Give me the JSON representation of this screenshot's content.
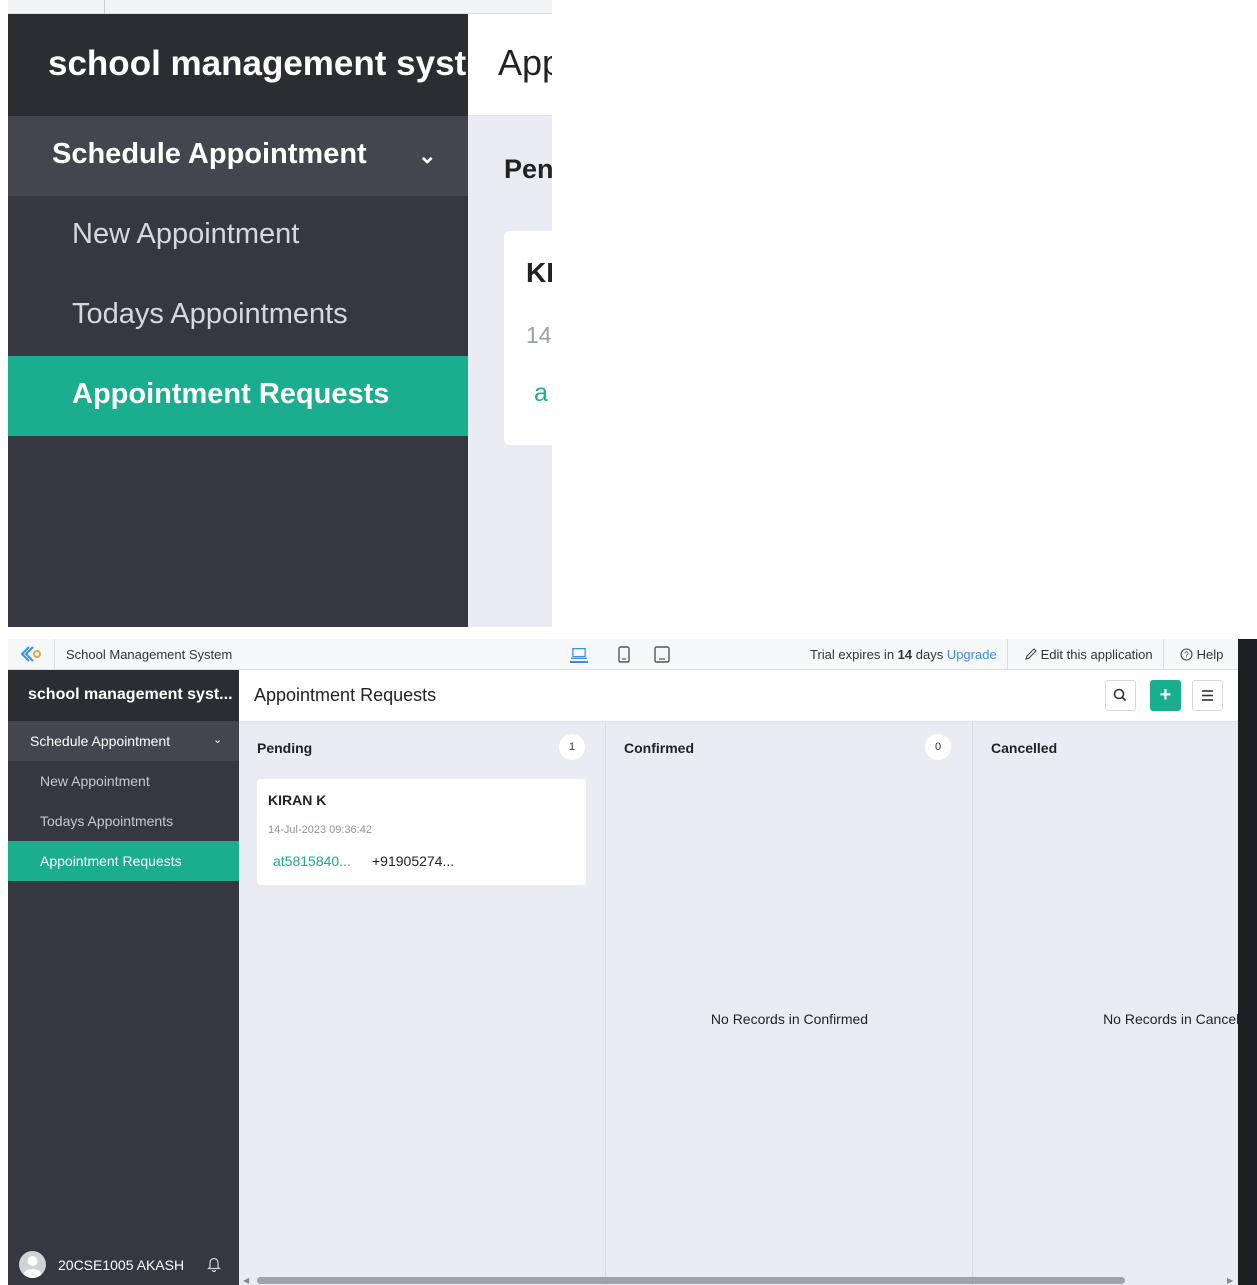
{
  "topbar": {
    "app_name": "School Management System",
    "trial_prefix": "Trial expires in ",
    "trial_days": "14",
    "trial_suffix": " days ",
    "upgrade_label": "Upgrade",
    "edit_label": "Edit this application",
    "help_label": "Help"
  },
  "sidebar": {
    "brand": "school management syst...",
    "group_label": "Schedule Appointment",
    "items": [
      {
        "label": "New Appointment"
      },
      {
        "label": "Todays Appointments"
      },
      {
        "label": "Appointment Requests"
      }
    ],
    "user_name": "20CSE1005 AKASH"
  },
  "zoom": {
    "header_title": "App",
    "column_label": "Pen",
    "card_name": "KI",
    "card_date": "14",
    "card_link": "a"
  },
  "main": {
    "title": "Appointment Requests",
    "columns": [
      {
        "title": "Pending",
        "count": "1"
      },
      {
        "title": "Confirmed",
        "count": "0",
        "empty": "No Records in Confirmed"
      },
      {
        "title": "Cancelled",
        "empty": "No Records in Cancelled"
      }
    ],
    "card": {
      "name": "KIRAN K",
      "date": "14-Jul-2023 09:36:42",
      "email": "at5815840...",
      "phone": "+91905274..."
    }
  },
  "colors": {
    "accent": "#1aad8e",
    "sidebar_bg": "#353840",
    "brand_bg": "#2b2d33",
    "link_blue": "#3a8ee6",
    "board_bg": "#e9edf3"
  },
  "icons": {
    "logo": "app-logo-icon",
    "desktop": "desktop-icon",
    "tablet": "tablet-icon",
    "mobile": "mobile-icon",
    "edit": "pencil-icon",
    "help": "help-circle-icon",
    "search": "search-icon",
    "add": "plus-icon",
    "menu": "hamburger-icon",
    "user": "avatar-icon",
    "bell": "bell-icon"
  }
}
